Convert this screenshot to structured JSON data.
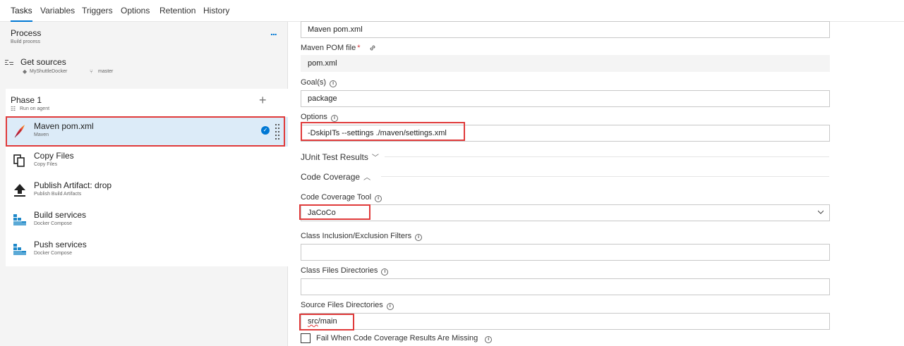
{
  "tabs": [
    "Tasks",
    "Variables",
    "Triggers",
    "Options",
    "Retention",
    "History"
  ],
  "process": {
    "title": "Process",
    "subtitle": "Build process",
    "more": "..."
  },
  "get_sources": {
    "title": "Get sources",
    "repo": "MyShuttleDocker",
    "branch": "master"
  },
  "phase": {
    "title": "Phase 1",
    "subtitle": "Run on agent"
  },
  "tasks": [
    {
      "title": "Maven pom.xml",
      "subtitle": "Maven",
      "icon": "maven-feather-icon",
      "selected": true
    },
    {
      "title": "Copy Files",
      "subtitle": "Copy Files",
      "icon": "copy-files-icon"
    },
    {
      "title": "Publish Artifact: drop",
      "subtitle": "Publish Build Artifacts",
      "icon": "upload-arrow-icon"
    },
    {
      "title": "Build services",
      "subtitle": "Docker Compose",
      "icon": "docker-icon"
    },
    {
      "title": "Push services",
      "subtitle": "Docker Compose",
      "icon": "docker-icon"
    }
  ],
  "form": {
    "display_name_value": "Maven pom.xml",
    "pom_label": "Maven POM file",
    "pom_required": "*",
    "pom_value": "pom.xml",
    "goals_label": "Goal(s)",
    "goals_value": "package",
    "options_label": "Options",
    "options_value": "-DskipITs --settings ./maven/settings.xml",
    "junit_section": "JUnit Test Results",
    "coverage_section": "Code Coverage",
    "coverage_tool_label": "Code Coverage Tool",
    "coverage_tool_value": "JaCoCo",
    "class_filters_label": "Class Inclusion/Exclusion Filters",
    "class_filters_value": "",
    "class_dirs_label": "Class Files Directories",
    "class_dirs_value": "",
    "source_dirs_label": "Source Files Directories",
    "source_dirs_prefix": "src",
    "source_dirs_suffix": "/main",
    "fail_missing_label": "Fail When Code Coverage Results Are Missing",
    "fail_missing_checked": false
  },
  "colors": {
    "accent": "#0078d4",
    "highlight": "#e03a3a",
    "selected_bg": "#dcebf8"
  }
}
